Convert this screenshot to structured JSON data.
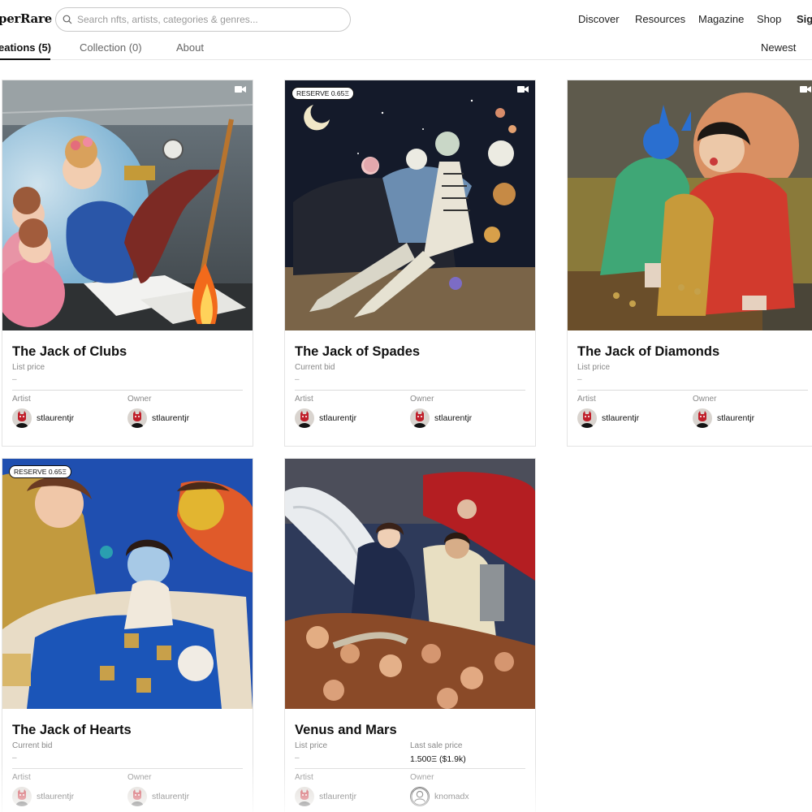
{
  "header": {
    "logo": "perRare",
    "search": {
      "placeholder": "Search nfts, artists, categories & genres..."
    },
    "nav": [
      "Discover",
      "Resources",
      "Magazine",
      "Shop",
      "Sign"
    ]
  },
  "tabs": {
    "items": [
      "eations (5)",
      "Collection (0)",
      "About"
    ],
    "sort": "Newest"
  },
  "cards": [
    {
      "title": "The Jack of Clubs",
      "price_label": "List price",
      "price_value": "–",
      "badge": "",
      "artist_label": "Artist",
      "artist": "stlaurentjr",
      "owner_label": "Owner",
      "owner": "stlaurentjr",
      "icon": "video-camera-icon"
    },
    {
      "title": "The Jack of Spades",
      "price_label": "Current bid",
      "price_value": "–",
      "badge": "RESERVE 0.65Ξ",
      "artist_label": "Artist",
      "artist": "stlaurentjr",
      "owner_label": "Owner",
      "owner": "stlaurentjr",
      "icon": "video-camera-icon"
    },
    {
      "title": "The Jack of Diamonds",
      "price_label": "List price",
      "price_value": "–",
      "badge": "",
      "artist_label": "Artist",
      "artist": "stlaurentjr",
      "owner_label": "Owner",
      "owner": "stlaurentjr",
      "icon": "video-camera-icon"
    },
    {
      "title": "The Jack of Hearts",
      "price_label": "Current bid",
      "price_value": "–",
      "badge": "RESERVE 0.65Ξ",
      "artist_label": "Artist",
      "artist": "stlaurentjr",
      "owner_label": "Owner",
      "owner": "stlaurentjr"
    },
    {
      "title": "Venus and Mars",
      "price_label": "List price",
      "price_value": "–",
      "last_sale_label": "Last sale price",
      "last_sale_value": "1.500Ξ ($1.9k)",
      "artist_label": "Artist",
      "artist": "stlaurentjr",
      "owner_label": "Owner",
      "owner": "knomadx"
    }
  ],
  "colors": {
    "accent": "#111111",
    "border": "#e4e4e4",
    "muted": "#888888"
  }
}
